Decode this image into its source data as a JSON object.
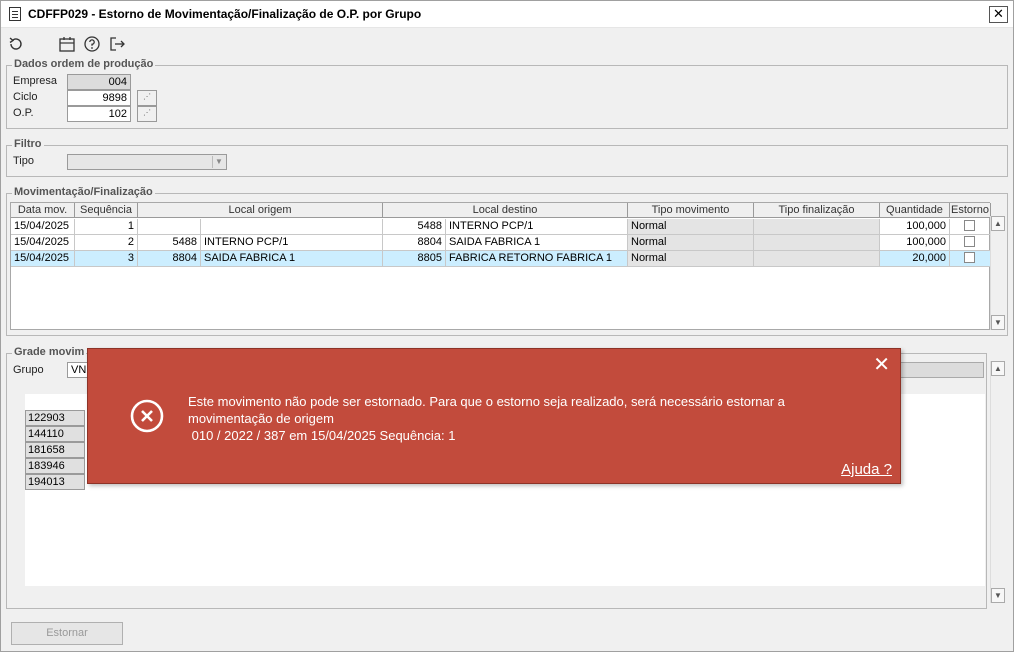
{
  "window": {
    "title": "CDFFP029 - Estorno de Movimentação/Finalização de O.P. por Grupo",
    "close_glyph": "✕"
  },
  "toolbar": {
    "icons": [
      "refresh-icon",
      "calendar-icon",
      "help-icon",
      "exit-icon"
    ]
  },
  "dados": {
    "title": "Dados ordem de produção",
    "empresa_label": "Empresa",
    "empresa_value": "004",
    "ciclo_label": "Ciclo",
    "ciclo_value": "9898",
    "op_label": "O.P.",
    "op_value": "102"
  },
  "filtro": {
    "title": "Filtro",
    "tipo_label": "Tipo",
    "tipo_value": ""
  },
  "movimentacao": {
    "title": "Movimentação/Finalização",
    "columns": [
      "Data mov.",
      "Sequência",
      "Local origem",
      "Local destino",
      "Tipo movimento",
      "Tipo finalização",
      "Quantidade",
      "Estorno"
    ],
    "rows": [
      {
        "data": "15/04/2025",
        "seq": "1",
        "orig_cod": "",
        "orig_desc": "",
        "dest_cod": "5488",
        "dest_desc": "INTERNO PCP/1",
        "tipo_mov": "Normal",
        "tipo_fin": "",
        "qtd": "100,000",
        "estorno": false
      },
      {
        "data": "15/04/2025",
        "seq": "2",
        "orig_cod": "5488",
        "orig_desc": "INTERNO PCP/1",
        "dest_cod": "8804",
        "dest_desc": "SAIDA FABRICA 1",
        "tipo_mov": "Normal",
        "tipo_fin": "",
        "qtd": "100,000",
        "estorno": false
      },
      {
        "data": "15/04/2025",
        "seq": "3",
        "orig_cod": "8804",
        "orig_desc": "SAIDA FABRICA 1",
        "dest_cod": "8805",
        "dest_desc": "FABRICA RETORNO FABRICA 1",
        "tipo_mov": "Normal",
        "tipo_fin": "",
        "qtd": "20,000",
        "estorno": false
      }
    ],
    "selected_row": 2
  },
  "grade": {
    "title": "Grade movim",
    "grupo_label": "Grupo",
    "grupo_value": "VN",
    "codes": [
      "122903",
      "144110",
      "181658",
      "183946",
      "194013"
    ]
  },
  "footer": {
    "estornar_label": "Estornar"
  },
  "dialog": {
    "line1": "Este movimento não pode ser estornado. Para que o estorno seja realizado, será necessário estornar a",
    "line2": "movimentação de origem",
    "line3": " 010 / 2022 / 387 em 15/04/2025 Sequência: 1",
    "close_glyph": "✕",
    "help_label": "Ajuda ?",
    "background_color": "#c24b3c"
  }
}
